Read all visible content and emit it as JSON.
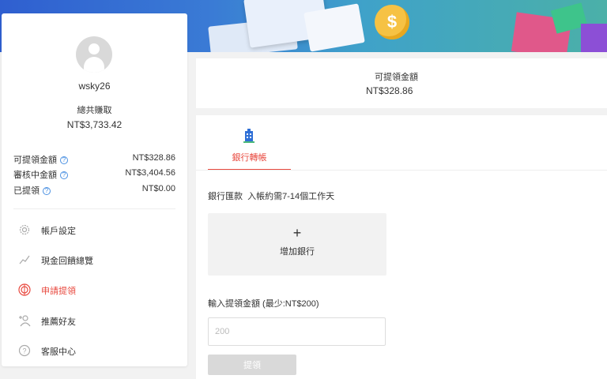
{
  "user": {
    "username": "wsky26",
    "total_earned_label": "總共賺取",
    "total_earned_value": "NT$3,733.42"
  },
  "stats": [
    {
      "label": "可提領金額",
      "value": "NT$328.86"
    },
    {
      "label": "審核中金額",
      "value": "NT$3,404.56"
    },
    {
      "label": "已提領",
      "value": "NT$0.00"
    }
  ],
  "help_icon_glyph": "?",
  "menu": [
    {
      "label": "帳戶設定",
      "icon": "gear-icon",
      "active": false
    },
    {
      "label": "現金回饋總覽",
      "icon": "chart-icon",
      "active": false
    },
    {
      "label": "申請提領",
      "icon": "withdraw-icon",
      "active": true
    },
    {
      "label": "推薦好友",
      "icon": "add-friend-icon",
      "active": false
    },
    {
      "label": "客服中心",
      "icon": "help-icon",
      "active": false
    }
  ],
  "balance": {
    "label": "可提領金額",
    "value": "NT$328.86"
  },
  "withdraw": {
    "tab_label": "銀行轉帳",
    "description": "銀行匯款  入帳約需7-14個工作天",
    "add_bank_plus": "+",
    "add_bank_label": "增加銀行",
    "amount_label": "輸入提領金額 (最少:NT$200)",
    "amount_placeholder": "200",
    "submit_label": "提領"
  },
  "banner": {
    "coin_symbol": "$"
  },
  "colors": {
    "accent": "#e8493f",
    "info": "#4a90e2",
    "bank_icon": "#2f6fd6"
  }
}
